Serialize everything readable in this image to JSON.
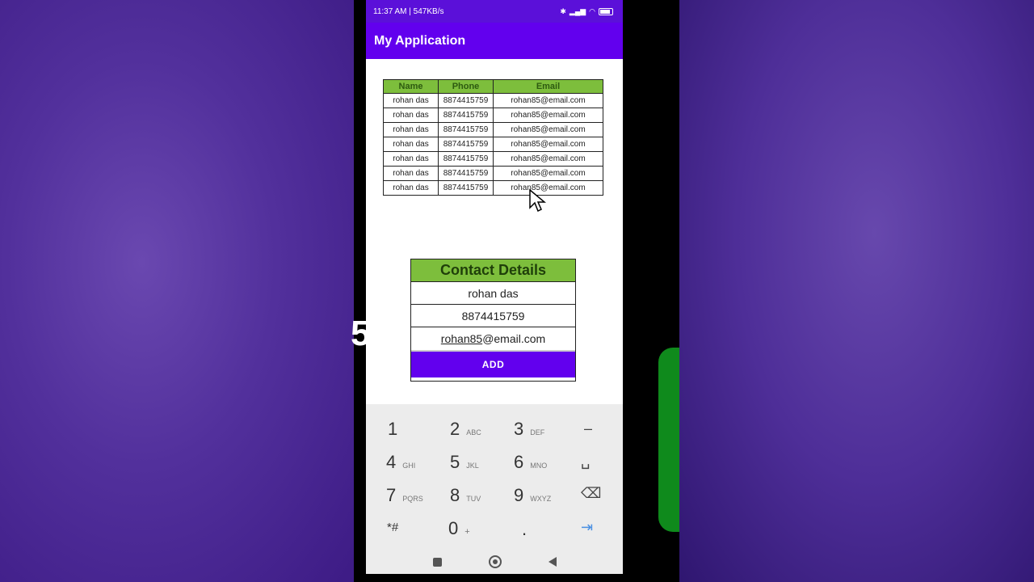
{
  "status_bar": {
    "time_speed": "11:37 AM | 547KB/s"
  },
  "app_bar": {
    "title": "My Application"
  },
  "table": {
    "headers": [
      "Name",
      "Phone",
      "Email"
    ],
    "rows": [
      [
        "rohan das",
        "8874415759",
        "rohan85@email.com"
      ],
      [
        "rohan das",
        "8874415759",
        "rohan85@email.com"
      ],
      [
        "rohan das",
        "8874415759",
        "rohan85@email.com"
      ],
      [
        "rohan das",
        "8874415759",
        "rohan85@email.com"
      ],
      [
        "rohan das",
        "8874415759",
        "rohan85@email.com"
      ],
      [
        "rohan das",
        "8874415759",
        "rohan85@email.com"
      ],
      [
        "rohan das",
        "8874415759",
        "rohan85@email.com"
      ]
    ]
  },
  "form": {
    "title": "Contact Details",
    "name_value": "rohan das",
    "phone_value": "8874415759",
    "email_user": "rohan85",
    "email_domain": "@email.com",
    "add_label": "ADD"
  },
  "keypad": {
    "keys": [
      {
        "digit": "1",
        "letters": ""
      },
      {
        "digit": "2",
        "letters": "ABC"
      },
      {
        "digit": "3",
        "letters": "DEF"
      },
      {
        "digit": "4",
        "letters": "GHI"
      },
      {
        "digit": "5",
        "letters": "JKL"
      },
      {
        "digit": "6",
        "letters": "MNO"
      },
      {
        "digit": "7",
        "letters": "PQRS"
      },
      {
        "digit": "8",
        "letters": "TUV"
      },
      {
        "digit": "9",
        "letters": "WXYZ"
      },
      {
        "digit": "*#",
        "letters": ""
      },
      {
        "digit": "0",
        "letters": "+"
      },
      {
        "digit": ".",
        "letters": ""
      }
    ],
    "function_keys": [
      "–",
      "␣",
      "⌫",
      "⇥"
    ]
  },
  "colors": {
    "primary": "#6200ee",
    "status": "#5b10d9",
    "header_green": "#7dbe3c"
  },
  "background": {
    "stray_glyph": "5"
  }
}
